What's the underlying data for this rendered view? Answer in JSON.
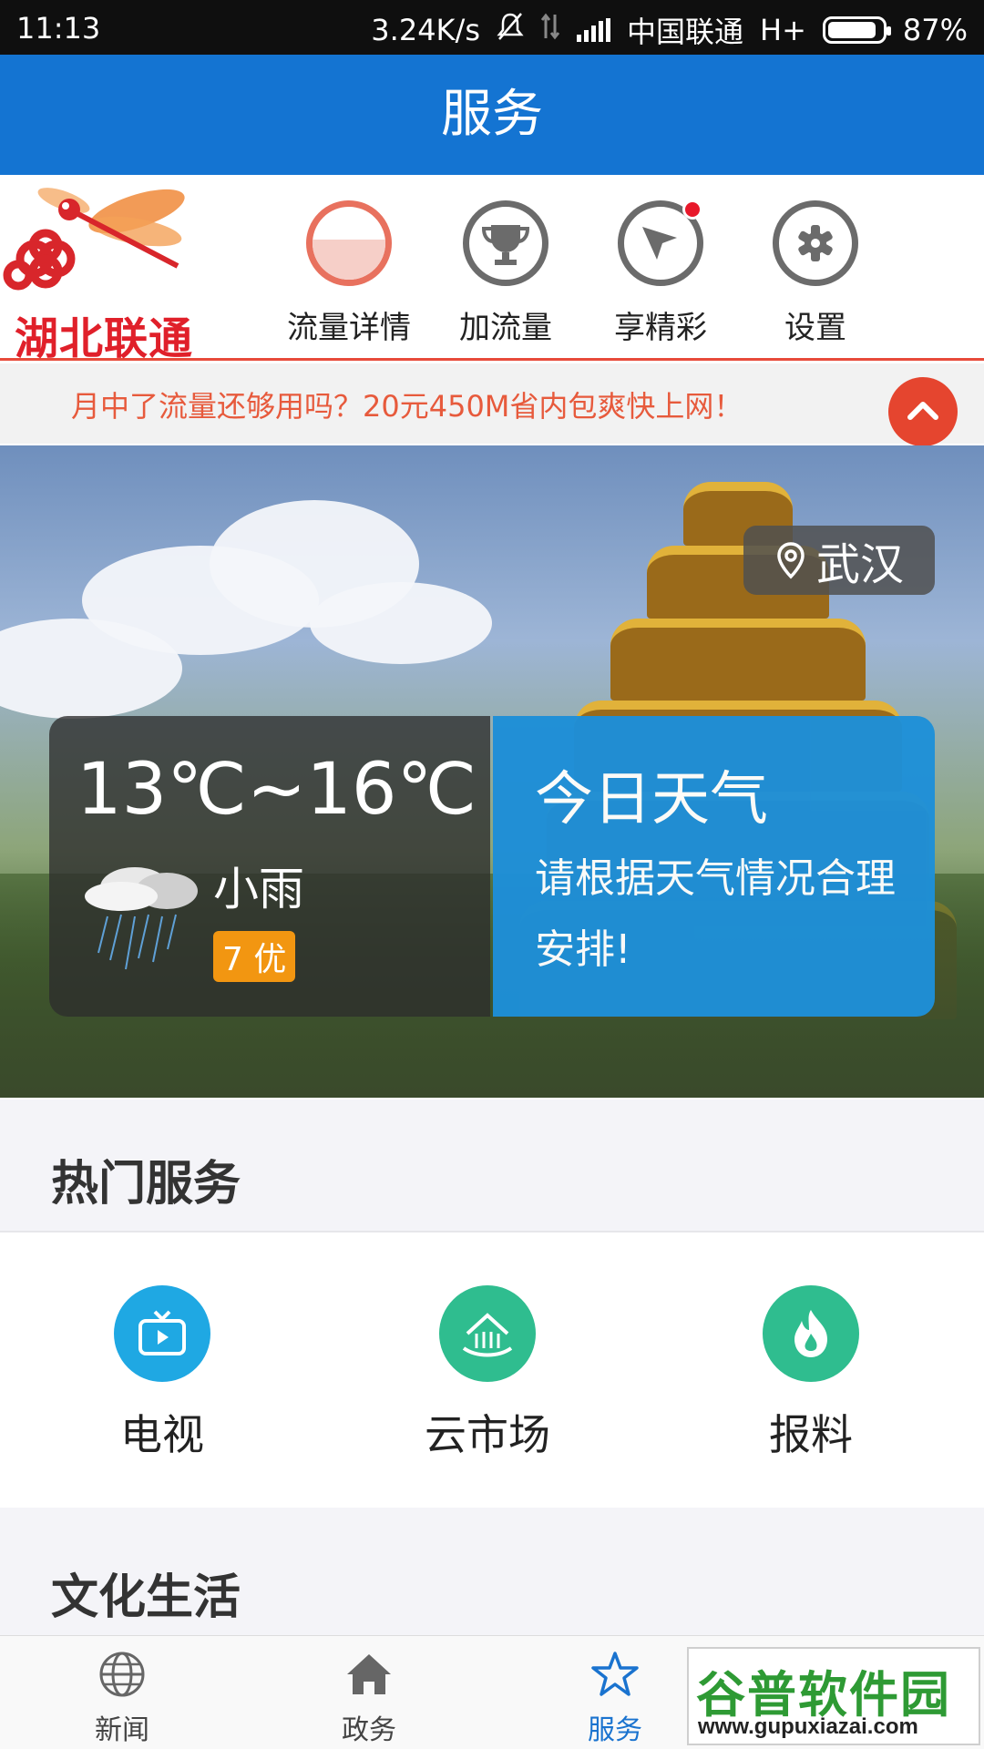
{
  "status_bar": {
    "time": "11:13",
    "speed": "3.24K/s",
    "carrier": "中国联通",
    "network": "H+",
    "battery": "87%"
  },
  "header": {
    "title": "服务"
  },
  "unicom_bar": {
    "brand": "湖北联通",
    "items": [
      {
        "label": "流量详情",
        "icon": "flow-gauge-icon"
      },
      {
        "label": "加流量",
        "icon": "trophy-icon"
      },
      {
        "label": "享精彩",
        "icon": "pointer-icon"
      },
      {
        "label": "设置",
        "icon": "gear-icon"
      }
    ]
  },
  "promo": {
    "text": "月中了流量还够用吗？20元450M省内包爽快上网！"
  },
  "weather": {
    "city": "武汉",
    "temp_range": "13℃~16℃",
    "condition": "小雨",
    "aqi": "7 优",
    "today_title": "今日天气",
    "today_desc": "请根据天气情况合理安排!"
  },
  "hot_services": {
    "title": "热门服务",
    "items": [
      {
        "label": "电视",
        "icon": "tv-icon",
        "color": "#1fa8e3"
      },
      {
        "label": "云市场",
        "icon": "cloud-market-icon",
        "color": "#2fbd8f"
      },
      {
        "label": "报料",
        "icon": "flame-icon",
        "color": "#2fbd8f"
      }
    ]
  },
  "culture": {
    "title": "文化生活"
  },
  "bottom_nav": {
    "items": [
      {
        "label": "新闻",
        "icon": "globe-icon"
      },
      {
        "label": "政务",
        "icon": "home-icon"
      },
      {
        "label": "服务",
        "icon": "star-icon",
        "active": true
      }
    ]
  },
  "watermark": {
    "title": "谷普软件园",
    "url": "www.gupuxiazai.com"
  },
  "colors": {
    "primary": "#1474d2",
    "accent_red": "#e5452f",
    "aqi_badge": "#f29611",
    "weather_card": "#1e8fd8"
  }
}
